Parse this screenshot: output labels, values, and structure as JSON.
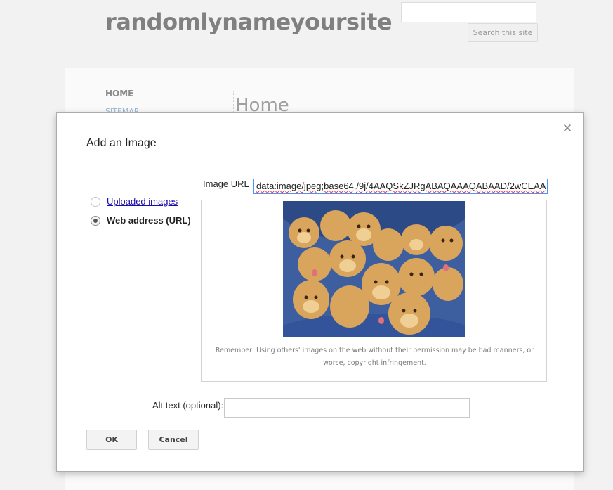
{
  "site": {
    "title": "randomlynameyoursite",
    "search_button_label": "Search this site",
    "nav": {
      "home": "HOME",
      "sitemap": "SITEMAP"
    },
    "page_title": "Home"
  },
  "dialog": {
    "title": "Add an Image",
    "close_icon": "close-icon",
    "source_options": [
      {
        "label": "Uploaded images",
        "selected": false
      },
      {
        "label": "Web address (URL)",
        "selected": true
      }
    ],
    "image_url_label": "Image URL",
    "image_url_value": "data:image/jpeg;base64,/9j/4AAQSkZJRgABAQAAAQABAAD/2wCEAA",
    "preview_notice": "Remember: Using others' images on the web without their permission may be bad manners, or worse, copyright infringement.",
    "alt_text_label": "Alt text (optional):",
    "alt_text_value": "",
    "ok_label": "OK",
    "cancel_label": "Cancel"
  },
  "colors": {
    "link": "#1a0dab",
    "focus_border": "#4d90fe"
  }
}
